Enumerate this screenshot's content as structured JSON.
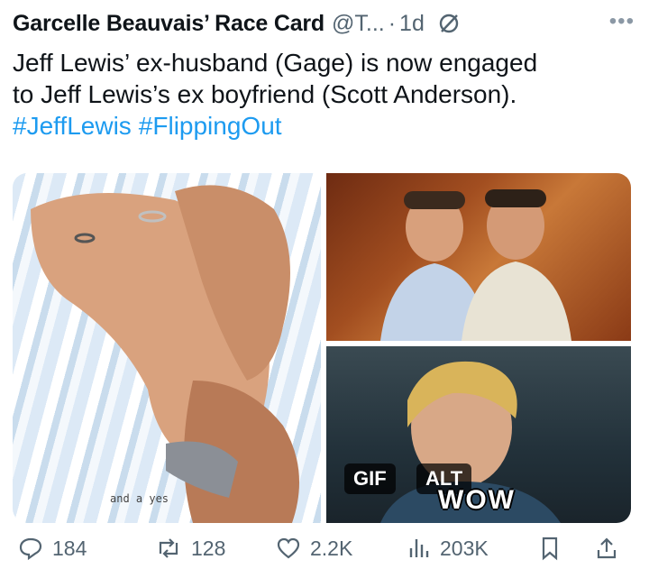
{
  "header": {
    "author_name": "Garcelle Beauvais’ Race Card",
    "handle": "@T...",
    "separator": "·",
    "time": "1d",
    "more_icon": "more-icon",
    "grok_icon": "grok-icon"
  },
  "tweet": {
    "line1": "Jeff Lewis’ ex-husband (Gage) is now engaged",
    "line2": "to Jeff Lewis’s ex boyfriend (Scott Anderson).",
    "hashtags": [
      "#JeffLewis",
      "#FlippingOut"
    ]
  },
  "media": {
    "left_caption": "and a yes",
    "gif_badge": "GIF",
    "alt_badge": "ALT",
    "gif_overlay_text": "WOW"
  },
  "actions": {
    "replies": "184",
    "reposts": "128",
    "likes": "2.2K",
    "views": "203K"
  },
  "colors": {
    "link": "#1d9bf0",
    "muted": "#536471",
    "text": "#0f1419"
  }
}
